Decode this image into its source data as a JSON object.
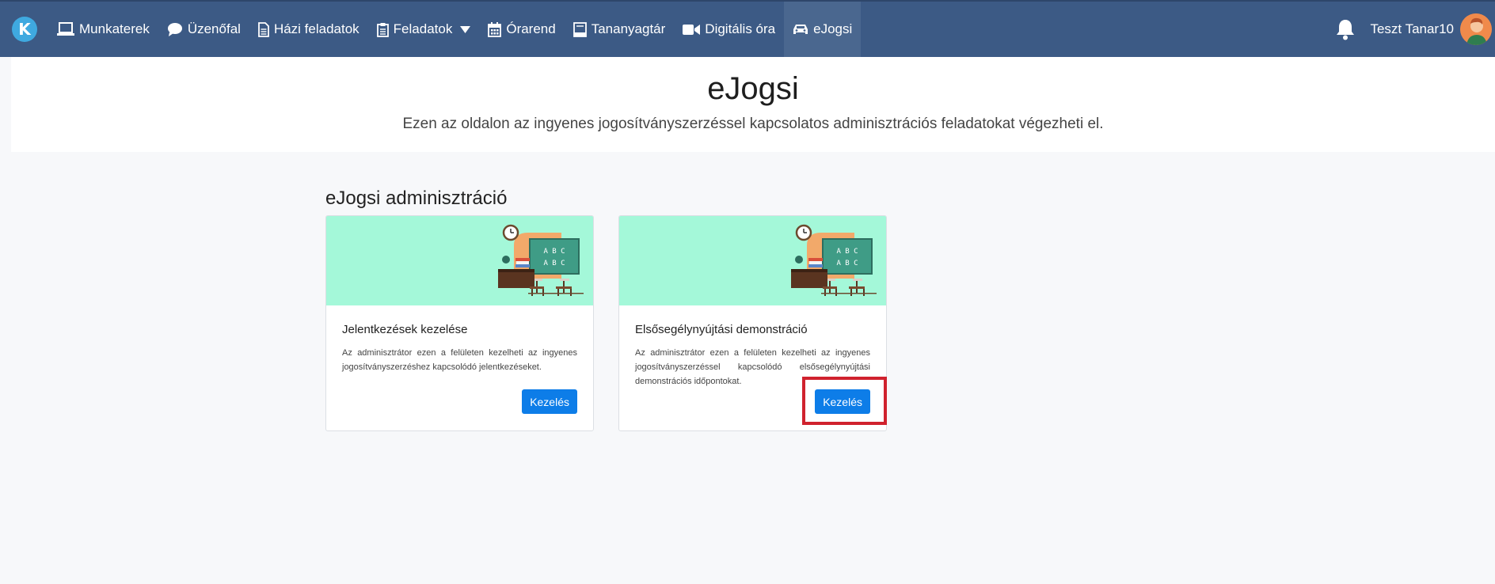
{
  "nav": {
    "brand_letter": "K",
    "items": [
      {
        "label": "Munkaterek",
        "icon": "laptop-icon"
      },
      {
        "label": "Üzenőfal",
        "icon": "comment-icon"
      },
      {
        "label": "Házi feladatok",
        "icon": "file-icon"
      },
      {
        "label": "Feladatok",
        "icon": "clipboard-icon"
      },
      {
        "label": "Órarend",
        "icon": "calendar-icon"
      },
      {
        "label": "Tananyagtár",
        "icon": "book-icon"
      },
      {
        "label": "Digitális óra",
        "icon": "video-icon"
      },
      {
        "label": "eJogsi",
        "icon": "car-icon"
      }
    ],
    "active_item": "eJogsi",
    "username": "Teszt Tanar10"
  },
  "header": {
    "title": "eJogsi",
    "subtitle": "Ezen az oldalon az ingyenes jogosítványszerzéssel kapcsolatos adminisztrációs feladatokat végezheti el."
  },
  "section": {
    "title": "eJogsi adminisztráció"
  },
  "cards": [
    {
      "title": "Jelentkezések kezelése",
      "text": "Az adminisztrátor ezen a felületen kezelheti az ingyenes jogosítványszerzéshez kapcsolódó jelentkezéseket.",
      "button": "Kezelés",
      "board_text": [
        "A B C",
        "A B C"
      ]
    },
    {
      "title": "Elsősegélynyújtási demonstráció",
      "text": "Az adminisztrátor ezen a felületen kezelheti az ingyenes jogosítványszerzéssel kapcsolódó elsősegélynyújtási demonstrációs időpontokat.",
      "button": "Kezelés",
      "board_text": [
        "A B C",
        "A B C"
      ]
    }
  ],
  "colors": {
    "navbar": "#3c5a85",
    "navbar_active": "#4a678f",
    "brand": "#3fa9e0",
    "card_banner": "#a4f8d9",
    "button": "#0d7de8",
    "highlight": "#d0222e"
  }
}
